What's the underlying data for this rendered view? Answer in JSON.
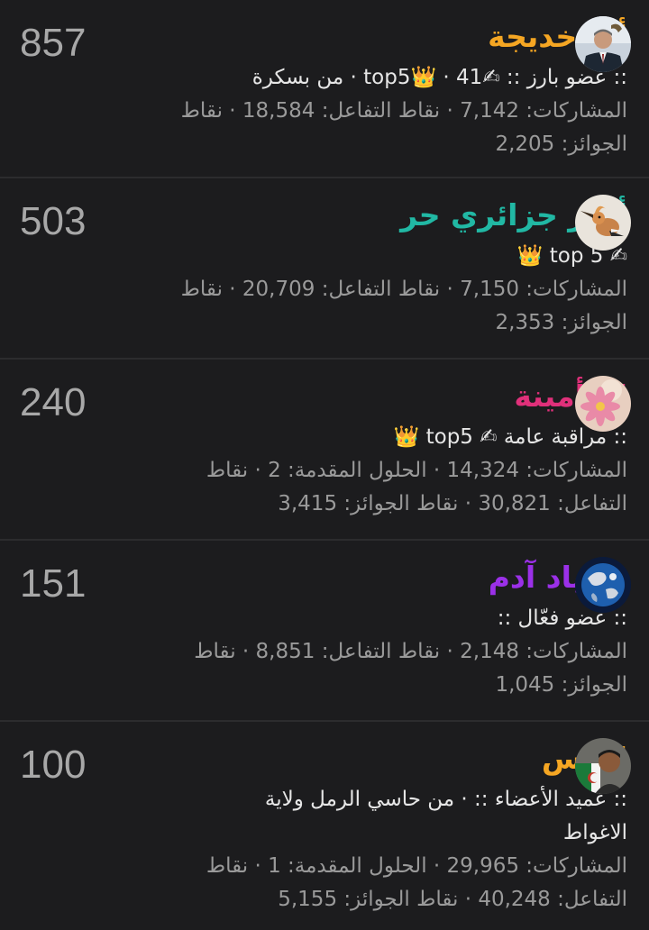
{
  "colors": {
    "background": "#1c1c1e",
    "divider": "#2c2c2e",
    "score": "#a8a8a8",
    "meta": "#9a9a9a"
  },
  "members": [
    {
      "name": "أبو خديجة",
      "name_color": "#f5a623",
      "score": "857",
      "title_line": ":: عضو بارز :: ✍top5👑 · 41 · من بسكرة",
      "stats_line_1": "المشاركات: 7,142 · نقاط التفاعل: 18,584 · نقاط",
      "stats_line_2": "الجوائز: 2,205",
      "avatar_icon": "man-in-suit-avatar"
    },
    {
      "name": "أمير جزائري حر",
      "name_color": "#21b8a4",
      "score": "503",
      "title_line": "✍ top 5 👑",
      "stats_line_1": "المشاركات: 7,150 · نقاط التفاعل: 20,709 · نقاط",
      "stats_line_2": "الجوائز: 2,353",
      "avatar_icon": "hoopoe-bird-avatar"
    },
    {
      "name": "ام أمينة",
      "name_color": "#e0307a",
      "score": "240",
      "title_line": ":: مراقبة عامة ✍ top5 👑",
      "stats_line_1": "المشاركات: 14,324 · الحلول المقدمة: 2 · نقاط",
      "stats_line_2": "التفاعل: 30,821 · نقاط الجوائز: 3,415",
      "avatar_icon": "pink-flower-avatar"
    },
    {
      "name": "حفياد آدم",
      "name_color": "#9b30e8",
      "score": "151",
      "title_line": ":: عضو فعّال ::",
      "stats_line_1": "المشاركات: 2,148 · نقاط التفاعل: 8,851 · نقاط",
      "stats_line_2": "الجوائز: 1,045",
      "avatar_icon": "earth-globe-avatar"
    },
    {
      "name": "إلياس",
      "name_color": "#f5a623",
      "score": "100",
      "title_line": ":: عميد الأعضاء :: · من حاسي الرمل ولاية",
      "title_line_2": "الاغواط",
      "stats_line_1": "المشاركات: 29,965 · الحلول المقدمة: 1 · نقاط",
      "stats_line_2": "التفاعل: 40,248 · نقاط الجوائز: 5,155",
      "avatar_icon": "man-with-flag-avatar"
    }
  ]
}
